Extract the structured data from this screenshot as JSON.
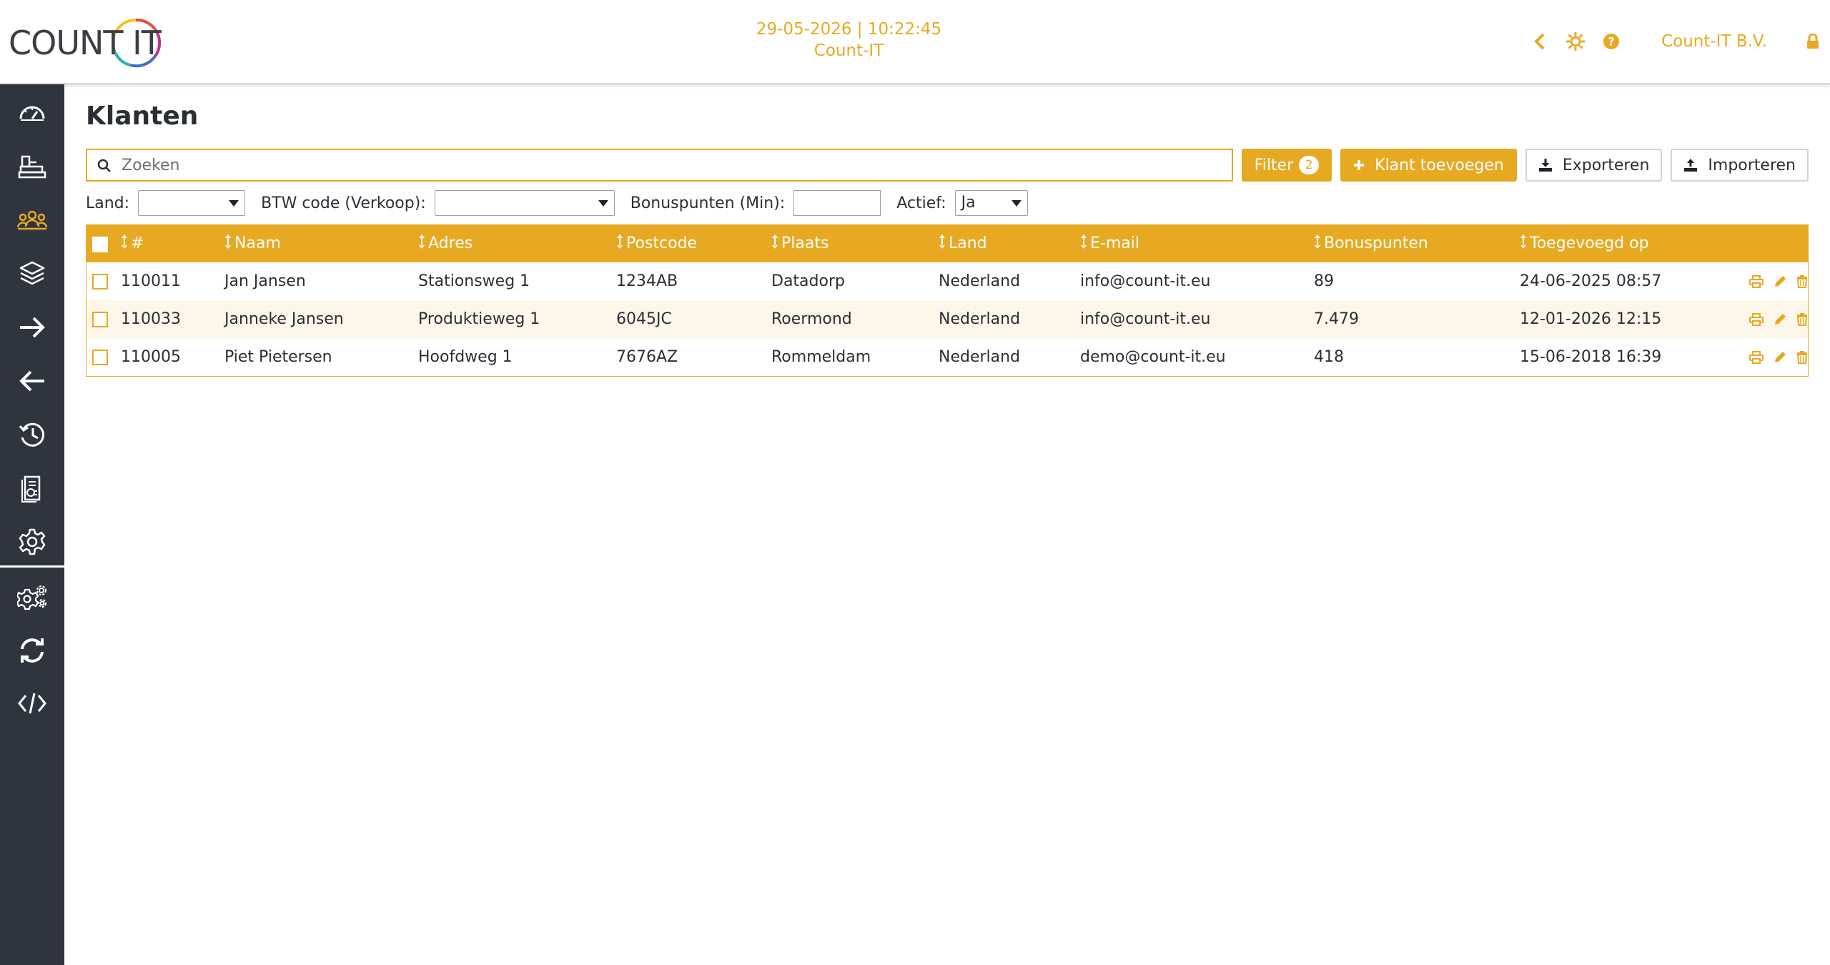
{
  "header": {
    "logo_text": "COUNT IT",
    "datetime": "29-05-2026 | 10:22:45",
    "subtitle": "Count-IT",
    "company": "Count-IT B.V.",
    "icons": [
      "chevron-left-icon",
      "sun-icon",
      "help-icon",
      "lock-icon"
    ]
  },
  "sidebar": {
    "items": [
      {
        "icon": "dashboard-icon",
        "active": false
      },
      {
        "icon": "cash-register-icon",
        "active": false
      },
      {
        "icon": "customers-icon",
        "active": true
      },
      {
        "icon": "products-icon",
        "active": false
      },
      {
        "icon": "arrow-right-icon",
        "active": false
      },
      {
        "icon": "arrow-left-icon",
        "active": false
      },
      {
        "icon": "history-icon",
        "active": false
      },
      {
        "icon": "reports-icon",
        "active": false
      },
      {
        "icon": "settings-icon",
        "active": false
      },
      {
        "icon": "advanced-settings-icon",
        "active": false
      },
      {
        "icon": "sync-icon",
        "active": false
      },
      {
        "icon": "code-icon",
        "active": false
      }
    ]
  },
  "page": {
    "title": "Klanten"
  },
  "toolbar": {
    "search_placeholder": "Zoeken",
    "search_value": "",
    "filter_label": "Filter",
    "filter_count": "2",
    "add_label": "Klant toevoegen",
    "export_label": "Exporteren",
    "import_label": "Importeren"
  },
  "filters": {
    "land_label": "Land:",
    "land_value": "",
    "btw_label": "BTW code (Verkoop):",
    "btw_value": "",
    "bonus_label": "Bonuspunten (Min):",
    "bonus_value": "",
    "actief_label": "Actief:",
    "actief_value": "Ja"
  },
  "table": {
    "columns": [
      "#",
      "Naam",
      "Adres",
      "Postcode",
      "Plaats",
      "Land",
      "E-mail",
      "Bonuspunten",
      "Toegevoegd op"
    ],
    "rows": [
      {
        "id": "110011",
        "naam": "Jan Jansen",
        "adres": "Stationsweg 1",
        "postcode": "1234AB",
        "plaats": "Datadorp",
        "land": "Nederland",
        "email": "info@count-it.eu",
        "bonus": "89",
        "toegevoegd": "24-06-2025 08:57"
      },
      {
        "id": "110033",
        "naam": "Janneke Jansen",
        "adres": "Produktieweg 1",
        "postcode": "6045JC",
        "plaats": "Roermond",
        "land": "Nederland",
        "email": "info@count-it.eu",
        "bonus": "7.479",
        "toegevoegd": "12-01-2026 12:15"
      },
      {
        "id": "110005",
        "naam": "Piet Pietersen",
        "adres": "Hoofdweg 1",
        "postcode": "7676AZ",
        "plaats": "Rommeldam",
        "land": "Nederland",
        "email": "demo@count-it.eu",
        "bonus": "418",
        "toegevoegd": "15-06-2018 16:39"
      }
    ]
  },
  "colors": {
    "accent": "#e8a922",
    "sidebar": "#2e353e",
    "row_alt": "#fdf7ea"
  }
}
